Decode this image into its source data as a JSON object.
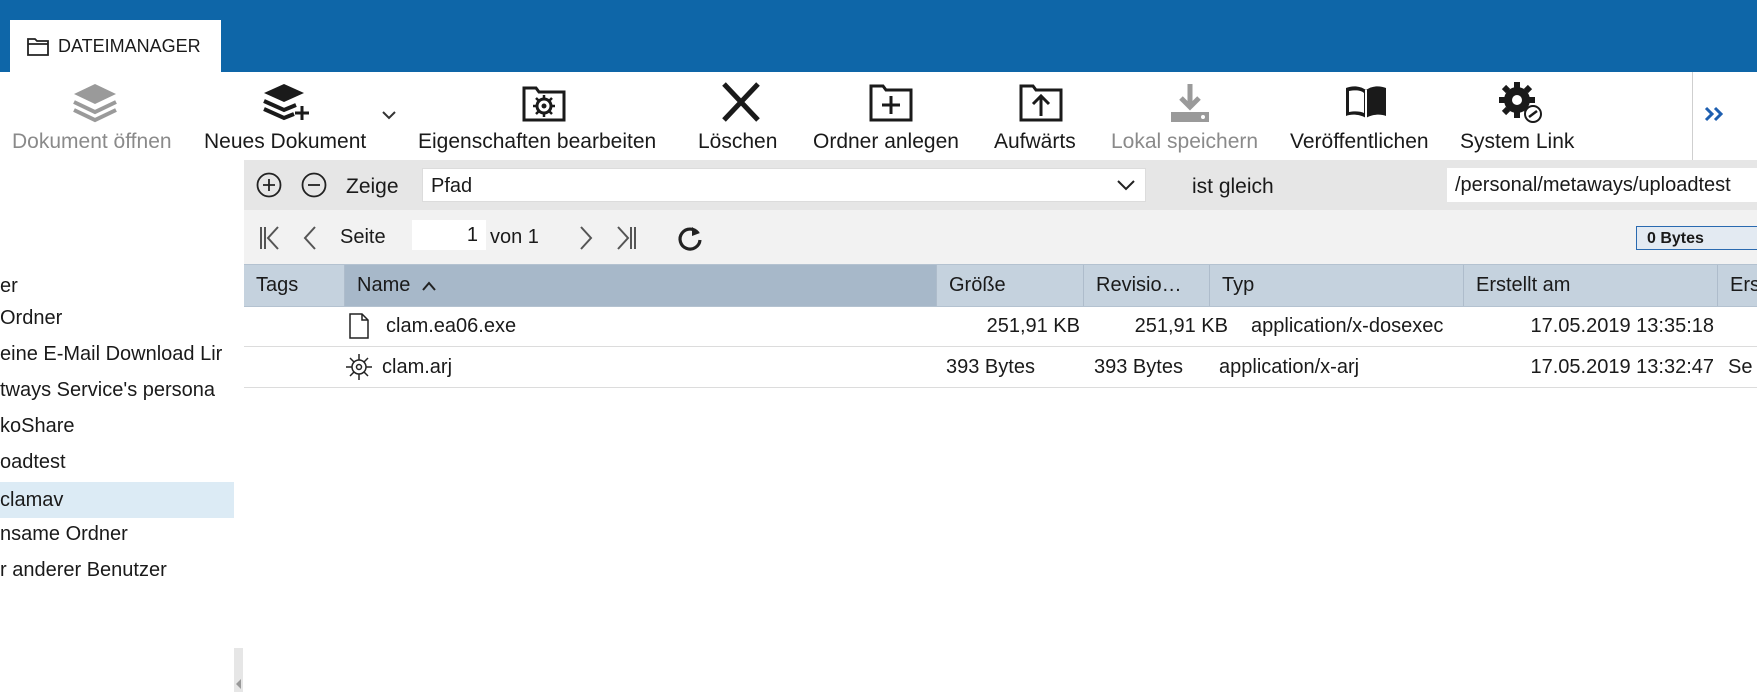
{
  "tab": {
    "label": "DATEIMANAGER"
  },
  "toolbar": {
    "open_document": "Dokument öffnen",
    "new_document": "Neues Dokument",
    "edit_properties": "Eigenschaften bearbeiten",
    "delete": "Löschen",
    "create_folder": "Ordner anlegen",
    "up": "Aufwärts",
    "save_local": "Lokal speichern",
    "publish": "Veröffentlichen",
    "system_link": "System Link"
  },
  "sidebar": {
    "items": [
      {
        "label": "er"
      },
      {
        "label": "Ordner"
      },
      {
        "label": "eine E-Mail Download Lir"
      },
      {
        "label": "tways Service's persona"
      },
      {
        "label": "koShare"
      },
      {
        "label": "oadtest"
      },
      {
        "label": "clamav"
      },
      {
        "label": "nsame Ordner"
      },
      {
        "label": "r anderer Benutzer"
      }
    ]
  },
  "filter": {
    "show_label": "Zeige",
    "field": "Pfad",
    "operator": "ist gleich",
    "value": "/personal/metaways/uploadtest"
  },
  "pager": {
    "page_label": "Seite",
    "page": "1",
    "of_label": "von 1",
    "size": "0 Bytes"
  },
  "grid": {
    "columns": {
      "tags": "Tags",
      "name": "Name",
      "size": "Größe",
      "revision": "Revisio…",
      "type": "Typ",
      "created": "Erstellt am",
      "creator": "Ers"
    },
    "rows": [
      {
        "name": "clam.ea06.exe",
        "size": "251,91 KB",
        "revision": "251,91 KB",
        "type": "application/x-dosexec",
        "created": "17.05.2019 13:35:18",
        "creator": ""
      },
      {
        "name": "clam.arj",
        "size": "393 Bytes",
        "revision": "393 Bytes",
        "type": "application/x-arj",
        "created": "17.05.2019 13:32:47",
        "creator": "Se"
      }
    ]
  }
}
